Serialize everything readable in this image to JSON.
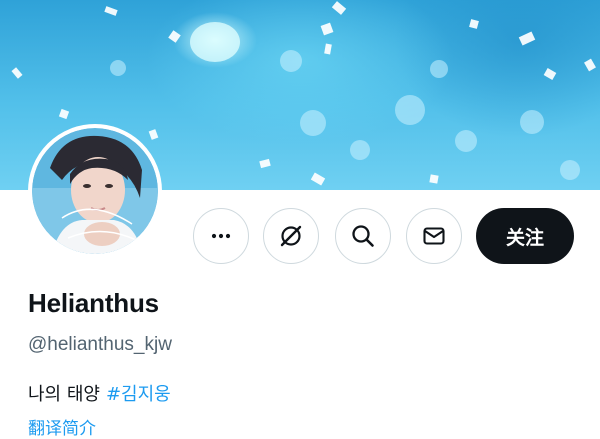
{
  "profile": {
    "display_name": "Helianthus",
    "handle": "@helianthus_kjw",
    "bio_text": "나의 태양",
    "bio_hashtag": "#김지웅",
    "translate_label": "翻译简介"
  },
  "actions": {
    "more_icon": "more-horizontal-icon",
    "grok_icon": "grok-slash-circle-icon",
    "search_icon": "search-icon",
    "message_icon": "envelope-icon",
    "follow_label": "关注"
  },
  "colors": {
    "banner": "#4bb8e6",
    "follow_bg": "#0f1419",
    "hashtag": "#1d9bf0",
    "handle": "#536471"
  }
}
